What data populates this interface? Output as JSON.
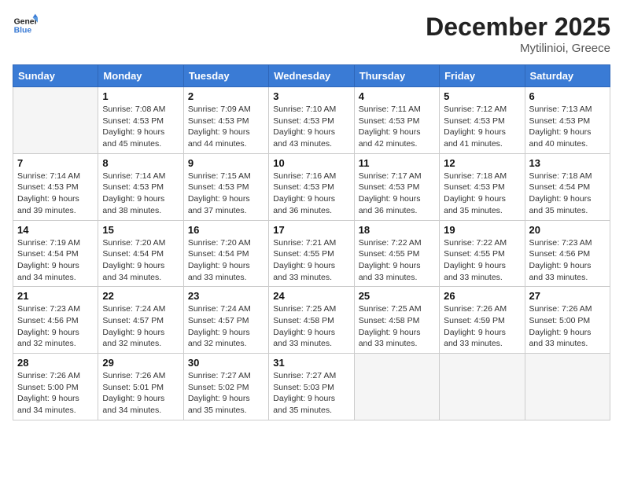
{
  "header": {
    "logo_line1": "General",
    "logo_line2": "Blue",
    "month": "December 2025",
    "location": "Mytilinioi, Greece"
  },
  "weekdays": [
    "Sunday",
    "Monday",
    "Tuesday",
    "Wednesday",
    "Thursday",
    "Friday",
    "Saturday"
  ],
  "weeks": [
    [
      {
        "day": "",
        "info": ""
      },
      {
        "day": "1",
        "info": "Sunrise: 7:08 AM\nSunset: 4:53 PM\nDaylight: 9 hours\nand 45 minutes."
      },
      {
        "day": "2",
        "info": "Sunrise: 7:09 AM\nSunset: 4:53 PM\nDaylight: 9 hours\nand 44 minutes."
      },
      {
        "day": "3",
        "info": "Sunrise: 7:10 AM\nSunset: 4:53 PM\nDaylight: 9 hours\nand 43 minutes."
      },
      {
        "day": "4",
        "info": "Sunrise: 7:11 AM\nSunset: 4:53 PM\nDaylight: 9 hours\nand 42 minutes."
      },
      {
        "day": "5",
        "info": "Sunrise: 7:12 AM\nSunset: 4:53 PM\nDaylight: 9 hours\nand 41 minutes."
      },
      {
        "day": "6",
        "info": "Sunrise: 7:13 AM\nSunset: 4:53 PM\nDaylight: 9 hours\nand 40 minutes."
      }
    ],
    [
      {
        "day": "7",
        "info": "Sunrise: 7:14 AM\nSunset: 4:53 PM\nDaylight: 9 hours\nand 39 minutes."
      },
      {
        "day": "8",
        "info": "Sunrise: 7:14 AM\nSunset: 4:53 PM\nDaylight: 9 hours\nand 38 minutes."
      },
      {
        "day": "9",
        "info": "Sunrise: 7:15 AM\nSunset: 4:53 PM\nDaylight: 9 hours\nand 37 minutes."
      },
      {
        "day": "10",
        "info": "Sunrise: 7:16 AM\nSunset: 4:53 PM\nDaylight: 9 hours\nand 36 minutes."
      },
      {
        "day": "11",
        "info": "Sunrise: 7:17 AM\nSunset: 4:53 PM\nDaylight: 9 hours\nand 36 minutes."
      },
      {
        "day": "12",
        "info": "Sunrise: 7:18 AM\nSunset: 4:53 PM\nDaylight: 9 hours\nand 35 minutes."
      },
      {
        "day": "13",
        "info": "Sunrise: 7:18 AM\nSunset: 4:54 PM\nDaylight: 9 hours\nand 35 minutes."
      }
    ],
    [
      {
        "day": "14",
        "info": "Sunrise: 7:19 AM\nSunset: 4:54 PM\nDaylight: 9 hours\nand 34 minutes."
      },
      {
        "day": "15",
        "info": "Sunrise: 7:20 AM\nSunset: 4:54 PM\nDaylight: 9 hours\nand 34 minutes."
      },
      {
        "day": "16",
        "info": "Sunrise: 7:20 AM\nSunset: 4:54 PM\nDaylight: 9 hours\nand 33 minutes."
      },
      {
        "day": "17",
        "info": "Sunrise: 7:21 AM\nSunset: 4:55 PM\nDaylight: 9 hours\nand 33 minutes."
      },
      {
        "day": "18",
        "info": "Sunrise: 7:22 AM\nSunset: 4:55 PM\nDaylight: 9 hours\nand 33 minutes."
      },
      {
        "day": "19",
        "info": "Sunrise: 7:22 AM\nSunset: 4:55 PM\nDaylight: 9 hours\nand 33 minutes."
      },
      {
        "day": "20",
        "info": "Sunrise: 7:23 AM\nSunset: 4:56 PM\nDaylight: 9 hours\nand 33 minutes."
      }
    ],
    [
      {
        "day": "21",
        "info": "Sunrise: 7:23 AM\nSunset: 4:56 PM\nDaylight: 9 hours\nand 32 minutes."
      },
      {
        "day": "22",
        "info": "Sunrise: 7:24 AM\nSunset: 4:57 PM\nDaylight: 9 hours\nand 32 minutes."
      },
      {
        "day": "23",
        "info": "Sunrise: 7:24 AM\nSunset: 4:57 PM\nDaylight: 9 hours\nand 32 minutes."
      },
      {
        "day": "24",
        "info": "Sunrise: 7:25 AM\nSunset: 4:58 PM\nDaylight: 9 hours\nand 33 minutes."
      },
      {
        "day": "25",
        "info": "Sunrise: 7:25 AM\nSunset: 4:58 PM\nDaylight: 9 hours\nand 33 minutes."
      },
      {
        "day": "26",
        "info": "Sunrise: 7:26 AM\nSunset: 4:59 PM\nDaylight: 9 hours\nand 33 minutes."
      },
      {
        "day": "27",
        "info": "Sunrise: 7:26 AM\nSunset: 5:00 PM\nDaylight: 9 hours\nand 33 minutes."
      }
    ],
    [
      {
        "day": "28",
        "info": "Sunrise: 7:26 AM\nSunset: 5:00 PM\nDaylight: 9 hours\nand 34 minutes."
      },
      {
        "day": "29",
        "info": "Sunrise: 7:26 AM\nSunset: 5:01 PM\nDaylight: 9 hours\nand 34 minutes."
      },
      {
        "day": "30",
        "info": "Sunrise: 7:27 AM\nSunset: 5:02 PM\nDaylight: 9 hours\nand 35 minutes."
      },
      {
        "day": "31",
        "info": "Sunrise: 7:27 AM\nSunset: 5:03 PM\nDaylight: 9 hours\nand 35 minutes."
      },
      {
        "day": "",
        "info": ""
      },
      {
        "day": "",
        "info": ""
      },
      {
        "day": "",
        "info": ""
      }
    ]
  ]
}
